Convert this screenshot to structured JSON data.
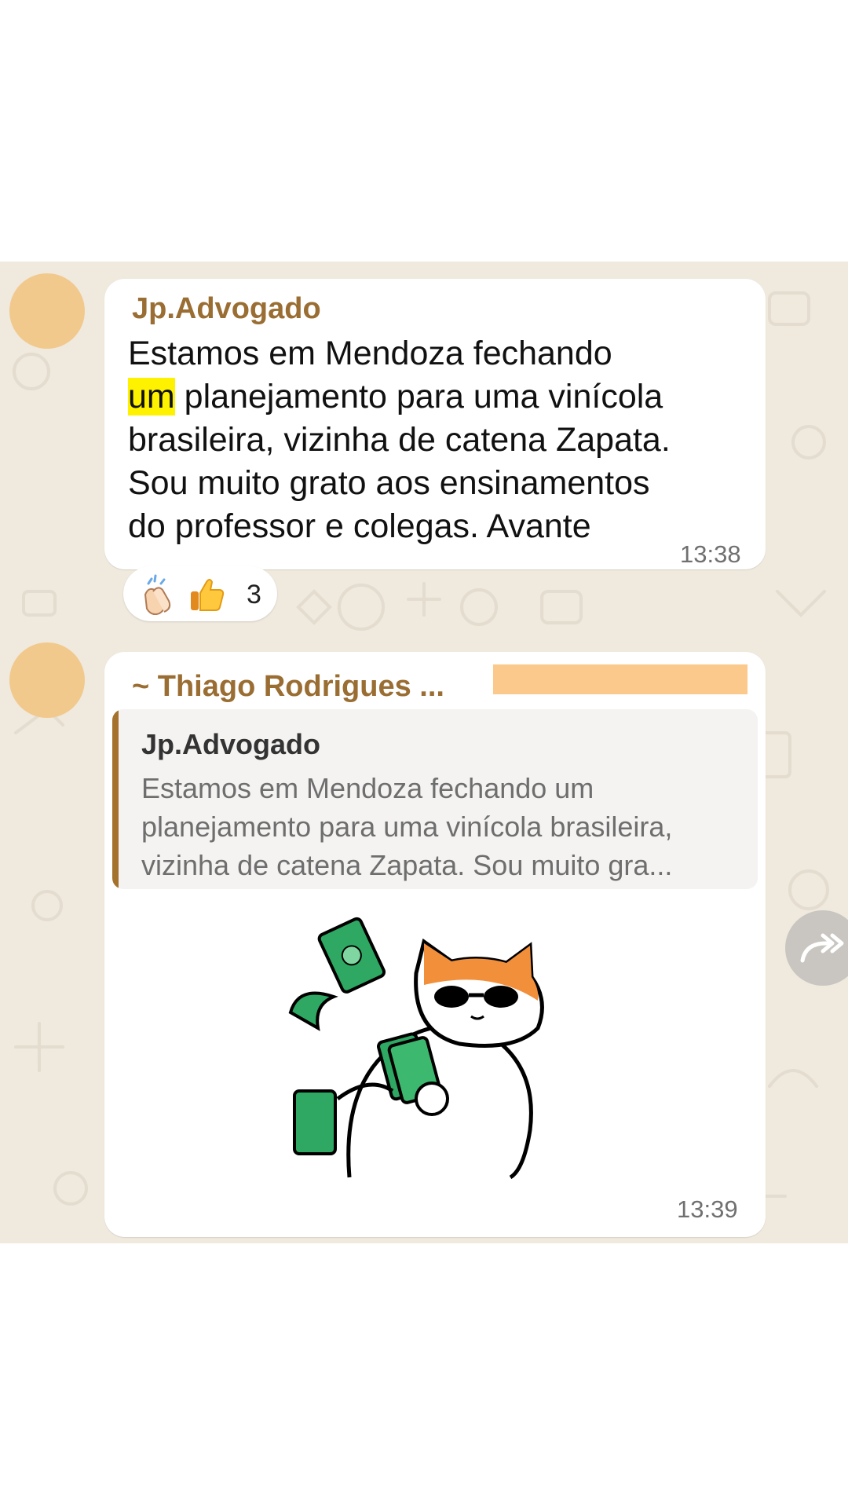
{
  "messages": [
    {
      "sender": "Jp.Advogado",
      "lines": [
        {
          "before": "Estamos em Mendoza fechando",
          "highlight": "",
          "after": ""
        },
        {
          "before": "",
          "highlight": "um",
          "after": " planejamento para uma vinícola"
        },
        {
          "before": "brasileira, vizinha de catena Zapata.",
          "highlight": "",
          "after": ""
        },
        {
          "before": "Sou muito grato aos ensinamentos",
          "highlight": "",
          "after": ""
        },
        {
          "before": "do professor e colegas. Avante",
          "highlight": "",
          "after": ""
        }
      ],
      "time": "13:38",
      "reactions": {
        "emojis": [
          "clapping-hands",
          "thumbs-up"
        ],
        "count": "3"
      }
    },
    {
      "sender": "~ Thiago Rodrigues ...",
      "quote": {
        "sender": "Jp.Advogado",
        "lines": [
          "Estamos em Mendoza fechando um",
          "planejamento para uma vinícola brasileira,",
          "vizinha de catena Zapata. Sou muito gra..."
        ]
      },
      "sticker": "cat-throwing-money-sticker",
      "time": "13:39"
    }
  ],
  "colors": {
    "wallpaper": "#efe9de",
    "sender_name": "#9a6d32",
    "highlight": "#fff200",
    "redaction": "#fbc98b",
    "avatar": "#f2c98c"
  },
  "icons": {
    "forward": "forward-icon"
  }
}
